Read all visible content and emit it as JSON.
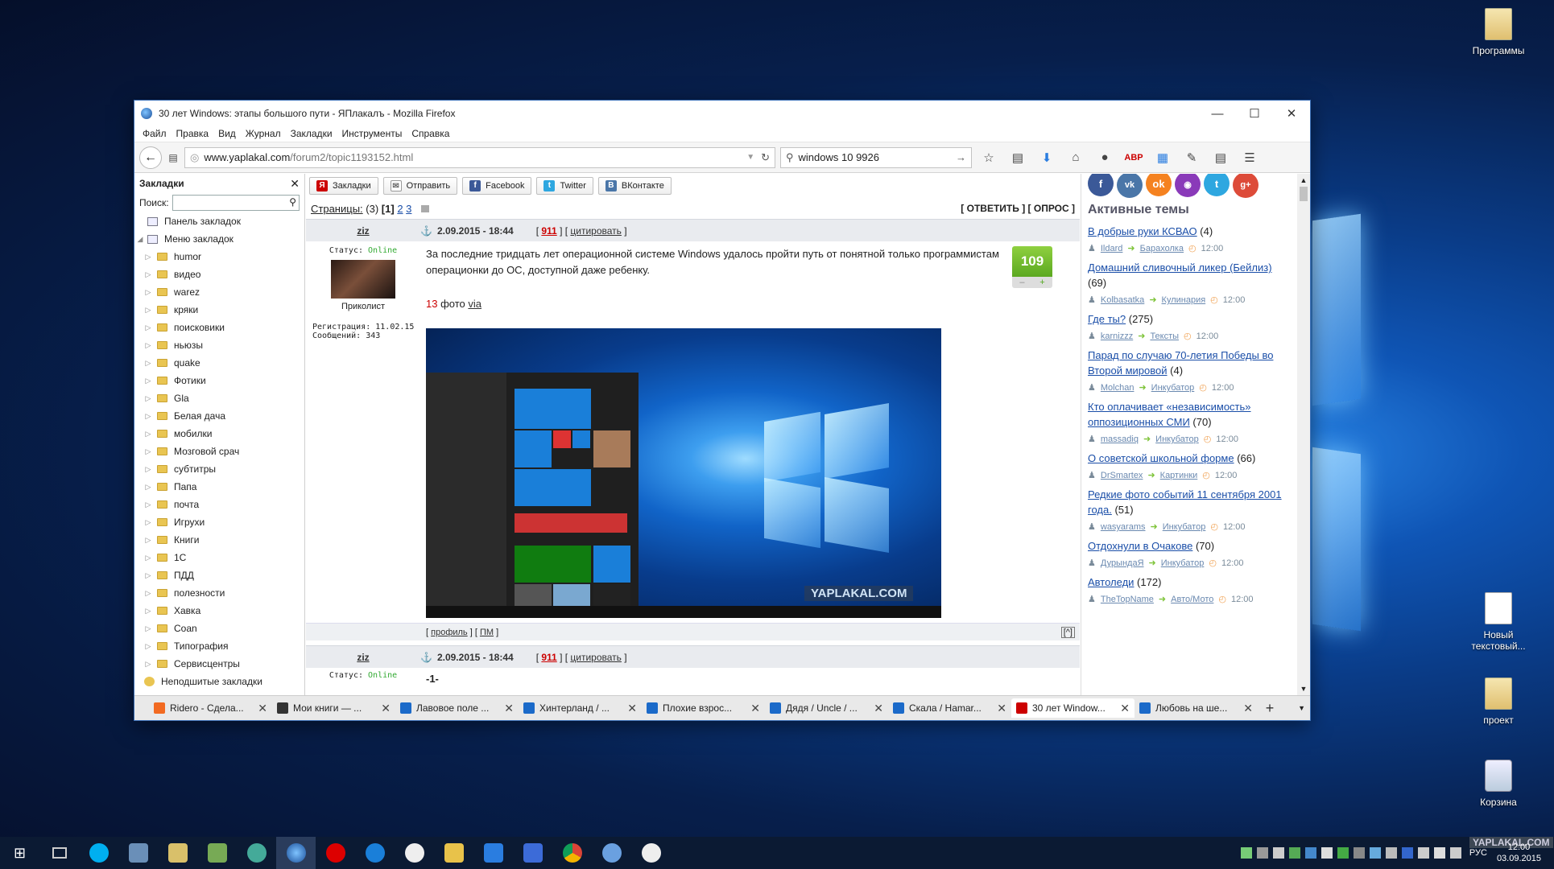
{
  "desktop": {
    "icons": [
      {
        "label": "Программы"
      },
      {
        "label": "Новый текстовый..."
      },
      {
        "label": "проект"
      },
      {
        "label": "Корзина"
      }
    ]
  },
  "window": {
    "title": "30 лет Windows: этапы большого пути - ЯПлакалъ - Mozilla Firefox",
    "minimize": "—",
    "maximize": "☐",
    "close": "✕"
  },
  "menu": [
    "Файл",
    "Правка",
    "Вид",
    "Журнал",
    "Закладки",
    "Инструменты",
    "Справка"
  ],
  "nav": {
    "url_domain": "www.yaplakal.com",
    "url_path": "/forum2/topic1193152.html",
    "search_value": "windows 10 9926"
  },
  "sidebar": {
    "title": "Закладки",
    "search_label": "Поиск:",
    "toolbar_item": "Панель закладок",
    "menu_item": "Меню закладок",
    "folders": [
      "humor",
      "видео",
      "warez",
      "кряки",
      "поисковики",
      "ньюзы",
      "quake",
      "Фотики",
      "Gla",
      "Белая дача",
      "мобилки",
      "Мозговой срач",
      "субтитры",
      "Папа",
      "почта",
      "Игрухи",
      "Книги",
      "1C",
      "ПДД",
      "полезности",
      "Хавка",
      "Coan",
      "Типография",
      "Сервисцентры"
    ],
    "unsorted": "Неподшитые закладки"
  },
  "content": {
    "share": {
      "bookmarks": "Закладки",
      "send": "Отправить",
      "facebook": "Facebook",
      "twitter": "Twitter",
      "vk": "ВКонтакте"
    },
    "pages_label": "Страницы:",
    "pages_count": "(3)",
    "page_current": "[1]",
    "page_2": "2",
    "page_3": "3",
    "actions": "[ ОТВЕТИТЬ ] [ ОПРОС ]",
    "post1": {
      "user": "ziz",
      "date": "2.09.2015 - 18:44",
      "num": "911",
      "quote": "цитировать",
      "status_label": "Статус:",
      "status": "Online",
      "rank": "Приколист",
      "reg": "Регистрация: 11.02.15",
      "msgs": "Сообщений: 343",
      "text": "За последние тридцать лет операционной системе Windows удалось пройти путь от понятной только программистам операционки до ОС, доступной даже ребенку.",
      "photos_count": "13",
      "photos_word": "фото",
      "via": "via",
      "rating": "109",
      "watermark": "YAPLAKAL.COM",
      "profile": "профиль",
      "pm": "ПМ",
      "top": "[^]"
    },
    "post2": {
      "user": "ziz",
      "date": "2.09.2015 - 18:44",
      "num": "911",
      "quote": "цитировать",
      "status_label": "Статус:",
      "status": "Online",
      "text": "-1-"
    }
  },
  "right": {
    "heading": "Активные темы",
    "topics": [
      {
        "title": "В добрые руки КСВАО",
        "count": "(4)",
        "user": "Ildard",
        "forum": "Барахолка",
        "time": "12:00"
      },
      {
        "title": "Домашний сливочный ликер (Бейлиз)",
        "count": "(69)",
        "user": "Kolbasatka",
        "forum": "Кулинария",
        "time": "12:00"
      },
      {
        "title": "Где ты?",
        "count": "(275)",
        "user": "karnizzz",
        "forum": "Тексты",
        "time": "12:00"
      },
      {
        "title": "Парад по случаю 70-летия Победы во Второй мировой",
        "count": "(4)",
        "user": "Molchan",
        "forum": "Инкубатор",
        "time": "12:00"
      },
      {
        "title": "Кто оплачивает «независимость» оппозиционных СМИ",
        "count": "(70)",
        "user": "massadiq",
        "forum": "Инкубатор",
        "time": "12:00"
      },
      {
        "title": "О советской школьной форме",
        "count": "(66)",
        "user": "DrSmartex",
        "forum": "Картинки",
        "time": "12:00"
      },
      {
        "title": "Редкие фото событий 11 сентября 2001 года.",
        "count": "(51)",
        "user": "wasyarams",
        "forum": "Инкубатор",
        "time": "12:00"
      },
      {
        "title": "Отдохнули в Очакове",
        "count": "(70)",
        "user": "ДурындаЯ",
        "forum": "Инкубатор",
        "time": "12:00"
      },
      {
        "title": "Автоледи",
        "count": "(172)",
        "user": "TheTopName",
        "forum": "Авто/Мото",
        "time": "12:00"
      }
    ]
  },
  "tabs": [
    {
      "label": "Ridero - Сдела...",
      "color": "#f26a21"
    },
    {
      "label": "Мои книги — ...",
      "color": "#333333"
    },
    {
      "label": "Лавовое поле ...",
      "color": "#1b6ac9"
    },
    {
      "label": "Хинтерланд / ...",
      "color": "#1b6ac9"
    },
    {
      "label": "Плохие взрос...",
      "color": "#1b6ac9"
    },
    {
      "label": "Дядя / Uncle / ...",
      "color": "#1b6ac9"
    },
    {
      "label": "Скала / Hamar...",
      "color": "#1b6ac9"
    },
    {
      "label": "30 лет Window...",
      "color": "#cc0000"
    },
    {
      "label": "Любовь на ше...",
      "color": "#1b6ac9"
    }
  ],
  "taskbar": {
    "lang": "РУС",
    "time": "12:00",
    "date": "03.09.2015",
    "watermark": "YAPLAKAL.COM"
  }
}
